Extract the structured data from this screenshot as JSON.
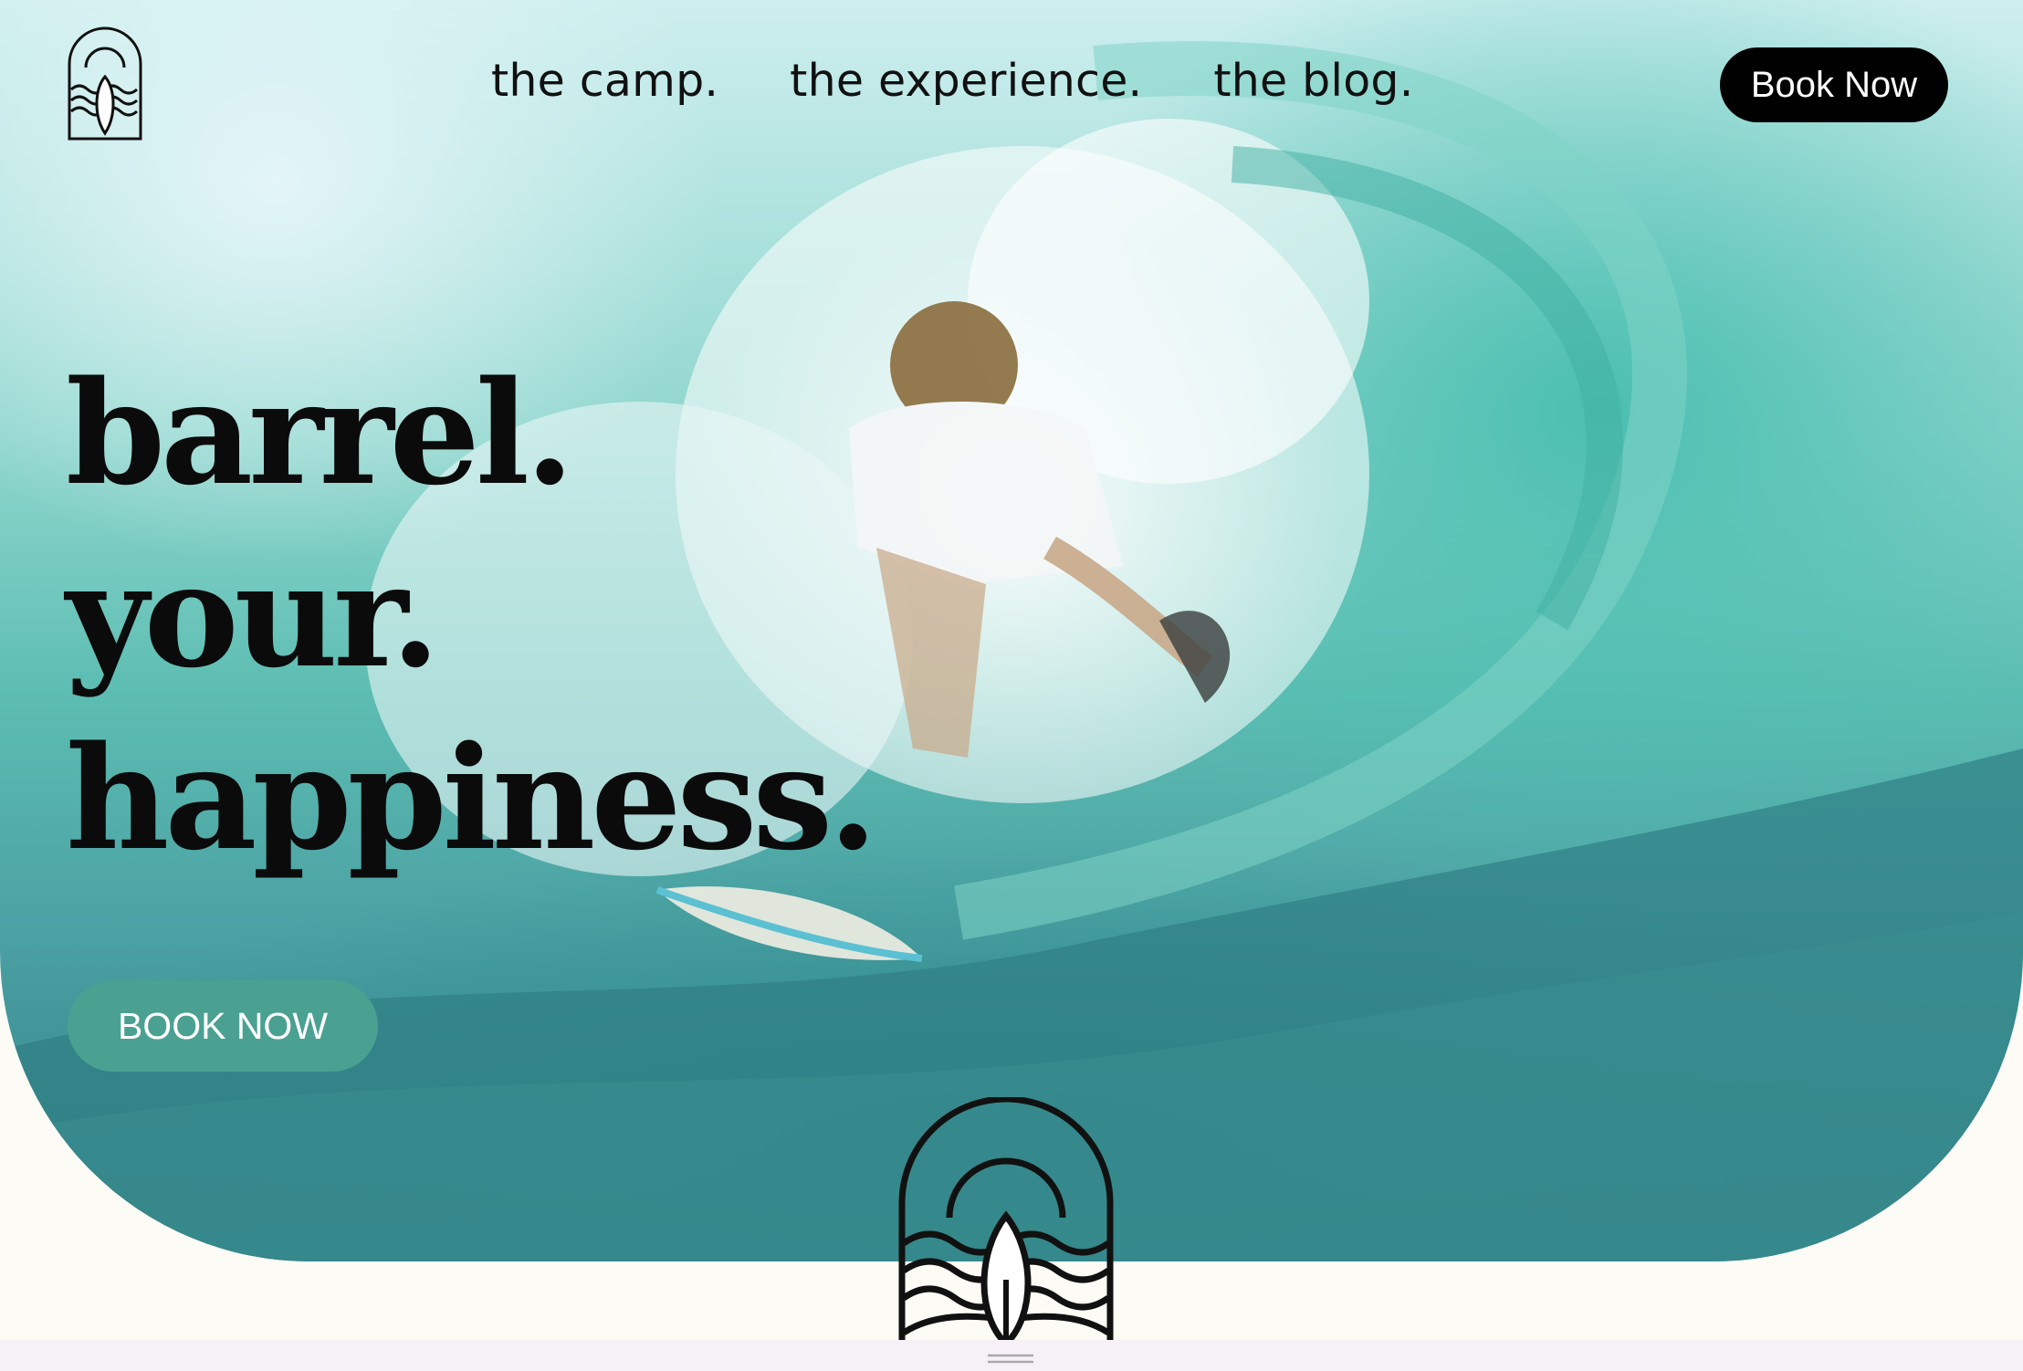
{
  "nav": {
    "items": [
      {
        "label": "the camp."
      },
      {
        "label": "the experience."
      },
      {
        "label": "the blog."
      }
    ],
    "book_label": "Book Now"
  },
  "hero": {
    "headline": [
      "barrel.",
      "your.",
      "happiness."
    ],
    "cta_label": "BOOK NOW"
  },
  "icons": {
    "brand_logo": "surf-logo-icon",
    "drag_handle": "drag-handle-icon"
  },
  "colors": {
    "accent": "#4aa191",
    "nav_button": "#000000",
    "background": "#fdfbf5",
    "text": "#0b0b0b"
  }
}
